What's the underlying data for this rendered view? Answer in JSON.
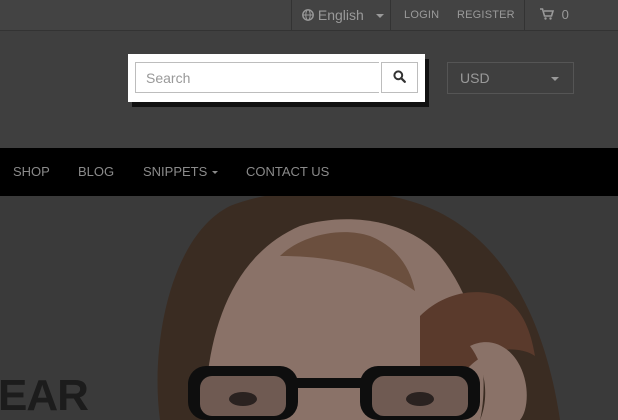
{
  "topbar": {
    "language": "English",
    "login": "LOGIN",
    "register": "REGISTER",
    "cart_count": "0"
  },
  "search": {
    "placeholder": "Search",
    "value": ""
  },
  "currency": {
    "selected": "USD"
  },
  "nav": {
    "items": [
      {
        "label": "SHOP"
      },
      {
        "label": "BLOG"
      },
      {
        "label": "SNIPPETS"
      },
      {
        "label": "CONTACT US"
      }
    ]
  },
  "hero": {
    "text": "EAR"
  },
  "colors": {
    "topbar": "#434343",
    "header": "#3f3f3f",
    "nav": "#000000",
    "highlight": "#ffffff"
  }
}
